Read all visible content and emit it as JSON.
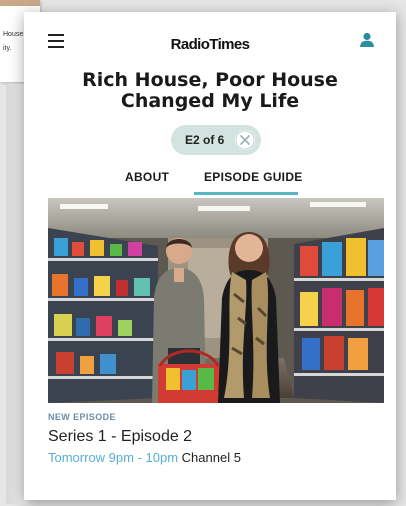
{
  "background_page": {
    "lines": [
      "House,",
      "ity."
    ]
  },
  "header": {
    "logo_text": "RadioTimes",
    "menu_icon": "hamburger-menu-icon",
    "account_icon": "user-account-icon"
  },
  "programme": {
    "title": "Rich House, Poor House Changed My Life"
  },
  "episode_selector": {
    "label": "E2 of 6",
    "clear_icon": "close-icon"
  },
  "tabs": [
    {
      "label": "ABOUT",
      "active": false
    },
    {
      "label": "EPISODE GUIDE",
      "active": true
    }
  ],
  "episode": {
    "badge": "NEW EPISODE",
    "title": "Series 1 - Episode 2",
    "time": "Tomorrow 9pm - 10pm",
    "channel": "Channel 5"
  },
  "colors": {
    "accent": "#55b8c2",
    "pill_bg": "#d2e3e0",
    "time_text": "#5aaed6",
    "badge_text": "#6b8ea8"
  }
}
